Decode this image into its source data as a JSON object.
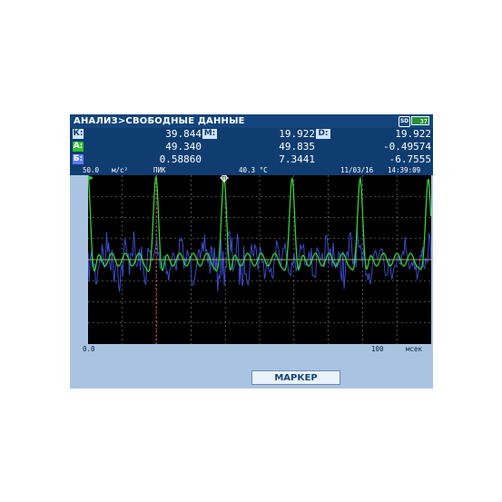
{
  "header": {
    "title": "АНАЛИЗ>СВОБОДНЫЕ ДАННЫЕ",
    "sd_icon": "SD",
    "battery": "37"
  },
  "readouts": {
    "row1": {
      "label1": "К:",
      "value1": "39.844",
      "label2": "М:",
      "value2": "19.922",
      "label3": "D:",
      "value3": "19.922"
    },
    "row2": {
      "label": "А:",
      "value1": "49.340",
      "value2": "49.835",
      "value3": "-0.49574"
    },
    "row3": {
      "label": "Б:",
      "value1": "0.58860",
      "value2": "7.3441",
      "value3": "-6.7555"
    }
  },
  "status": {
    "scale": "50.0",
    "units": "м/с²",
    "mode": "ПИК",
    "temperature": "40.3 °С",
    "date": "11/03/16",
    "time": "14:39:09"
  },
  "xaxis": {
    "min": "0.0",
    "max": "100",
    "unit": "мсек"
  },
  "softkey": {
    "label": "МАРКЕР"
  },
  "colors": {
    "green_trace": "#33d13a",
    "blue_trace": "#3f52d8",
    "cursor": "#e23a2a",
    "baseline": "#c8d86b"
  }
}
